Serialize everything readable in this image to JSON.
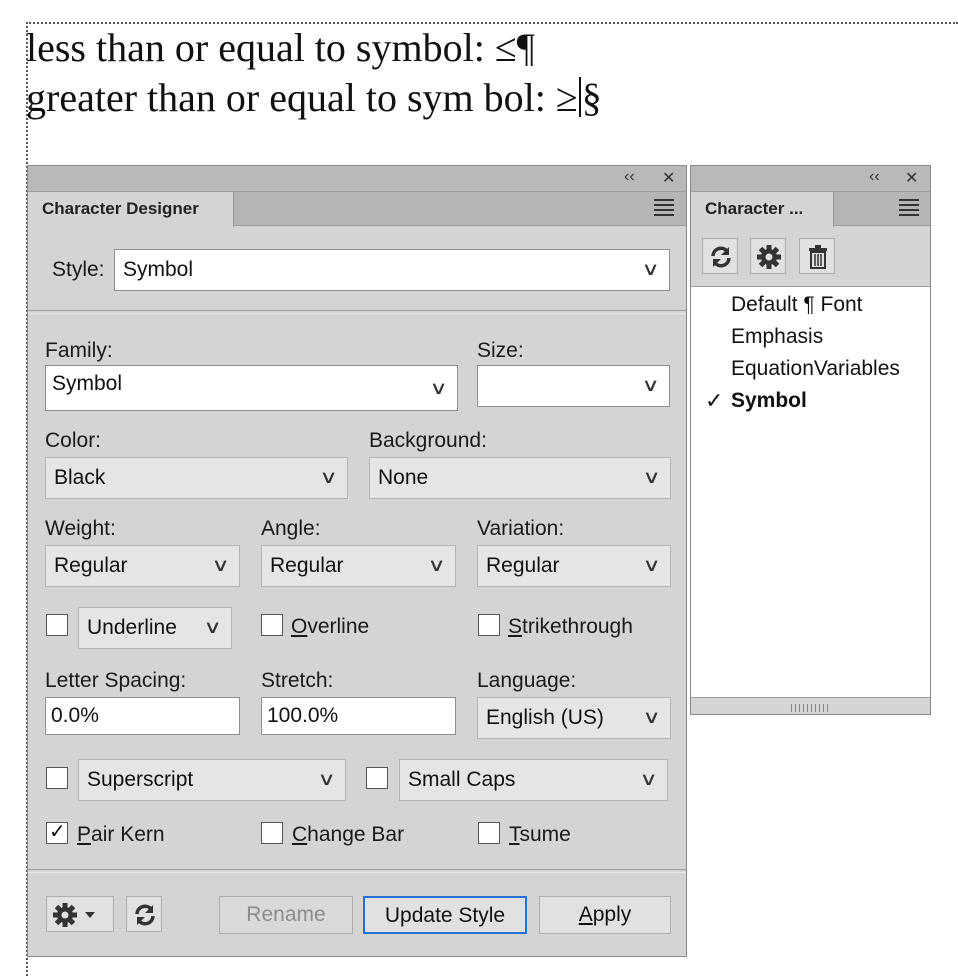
{
  "document": {
    "line1": "less than or equal to symbol: ≤¶",
    "line2_before": "greater than or equal to sym bol: ≥",
    "line2_after": "§"
  },
  "designer": {
    "tab_label": "Character Designer",
    "collapse_glyph": "‹‹",
    "close_glyph": "✕",
    "style_label": "Style:",
    "style_value": "Symbol",
    "family_label": "Family:",
    "family_value": "Symbol",
    "size_label": "Size:",
    "size_value": "",
    "color_label": "Color:",
    "color_value": "Black",
    "background_label": "Background:",
    "background_value": "None",
    "weight_label": "Weight:",
    "weight_value": "Regular",
    "angle_label": "Angle:",
    "angle_value": "Regular",
    "variation_label": "Variation:",
    "variation_value": "Regular",
    "underline_value": "Underline",
    "overline_first": "O",
    "overline_rest": "verline",
    "strike_first": "S",
    "strike_rest": "trikethrough",
    "letter_spacing_label": "Letter Spacing:",
    "letter_spacing_value": "0.0%",
    "stretch_label": "Stretch:",
    "stretch_value": "100.0%",
    "language_label": "Language:",
    "language_value": "English (US)",
    "superscript_value": "Superscript",
    "smallcaps_value": "Small Caps",
    "pairkern_first": "P",
    "pairkern_rest": "air Kern",
    "pairkern_checked": true,
    "changebar_first": "C",
    "changebar_rest": "hange Bar",
    "tsume_first": "T",
    "tsume_rest": "sume",
    "rename_label": "Rename",
    "update_label": "Update Style",
    "apply_first": "A",
    "apply_rest": "pply",
    "chevron": "∨"
  },
  "catalog": {
    "tab_label": "Character ...",
    "items": [
      {
        "label": "Default ¶ Font",
        "selected": false
      },
      {
        "label": "Emphasis",
        "selected": false
      },
      {
        "label": "EquationVariables",
        "selected": false
      },
      {
        "label": "Symbol",
        "selected": true
      }
    ],
    "check_glyph": "✓"
  },
  "colors": {
    "panel_bg": "#d4d4d4",
    "focus_border": "#2a6fd6"
  }
}
